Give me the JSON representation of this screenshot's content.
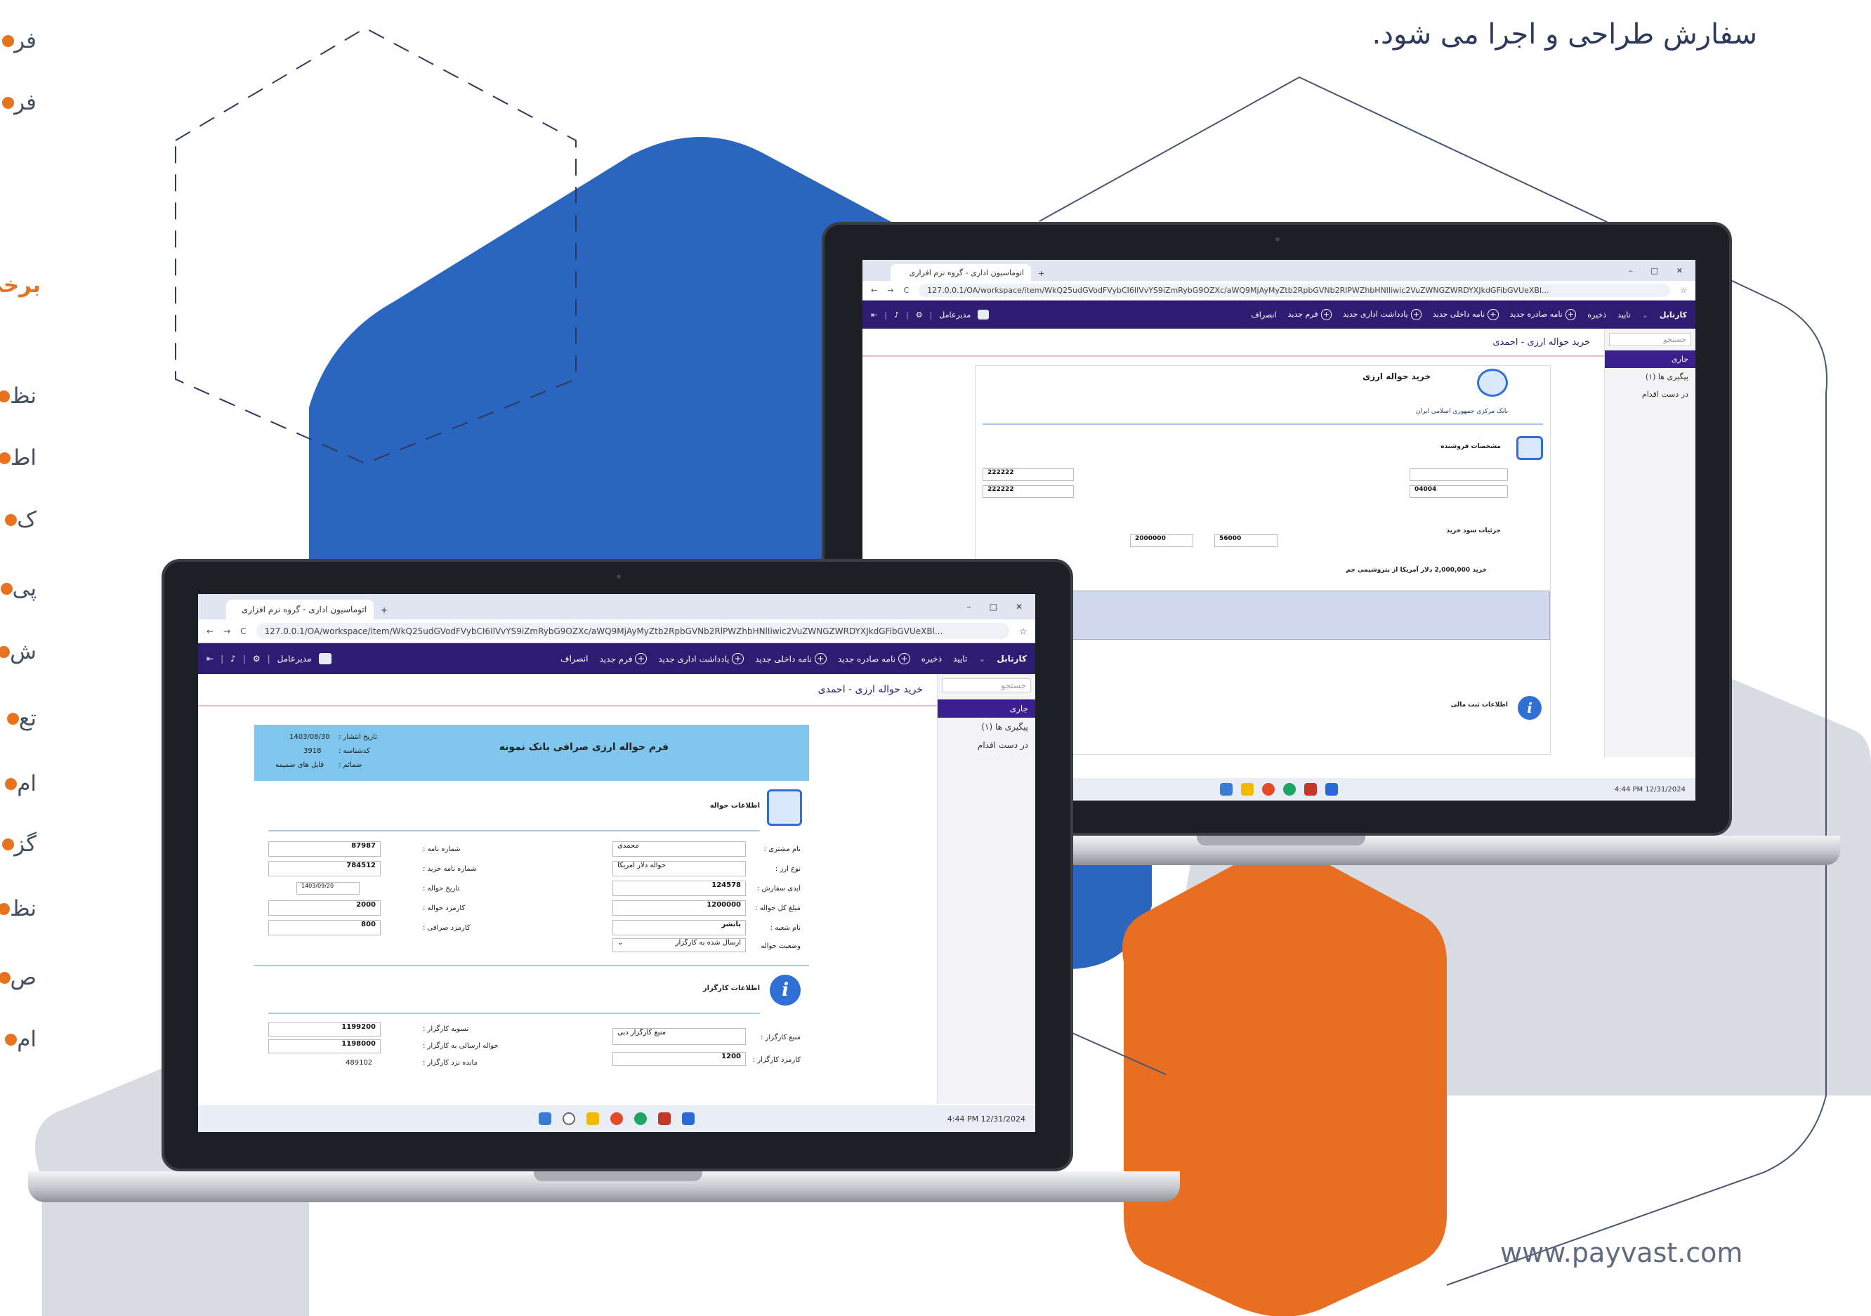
{
  "tagline": "سفارش طراحی و اجرا می شود.",
  "website": "www.payvast.com",
  "left_list": {
    "top": [
      "فر",
      "فر"
    ],
    "heading": "برخی",
    "items": [
      "نظ",
      "اط",
      "ک",
      "پی",
      "ش",
      "تع",
      "ام",
      "گز",
      "نظ",
      "ص",
      "ام"
    ]
  },
  "browser": {
    "tab_title": "اتوماسیون اداری - گروه نرم افزاری",
    "url": "127.0.0.1/OA/workspace/item/WkQ25udGVodFVybCI6IlVvYS9iZmRybG9OZXc/aWQ9MjAyMyZtb2RpbGVNb2RlPWZhbHNlIiwic2VuZWNGZWRDYXJkdGFibGVUeXBl..."
  },
  "app": {
    "cartable": "کارتابل",
    "toolbar": [
      "تایید",
      "ذخیره",
      "نامه صادره جدید",
      "نامه داخلی جدید",
      "یادداشت اداری جدید",
      "فرم جدید",
      "انصراف"
    ],
    "user": "مدیرعامل"
  },
  "sidebar": {
    "search": "جستجو",
    "items": [
      "جاری",
      "پیگیری ها (۱)",
      "در دست اقدام"
    ]
  },
  "pages": {
    "front_title": "خرید حواله ارزی - احمدی",
    "back_title": "خرید حواله ارزی - احمدی",
    "back_form_title": "خرید حواله ارزی",
    "back_bank": "بانک مرکزی جمهوری اسلامی ایران",
    "back_sections": [
      "مشخصات فروشنده",
      "جزئیات سود خرید",
      "اطلاعات ثبت مالی"
    ],
    "back_values": [
      "222222",
      "222222",
      "04004",
      "2000000",
      "56000"
    ],
    "back_summary": "خرید 2,000,000 دلار آمریکا از پتروشیمی جم"
  },
  "form": {
    "title": "فرم حواله ارزی صرافی بانک نمونه",
    "header": [
      {
        "label": "تاریخ انتشار :",
        "value": "1403/08/30"
      },
      {
        "label": "کدشناسه :",
        "value": "3918"
      },
      {
        "label": "ضمائم :",
        "value": "فایل های ضمیمه"
      }
    ],
    "section1": "اطلاعات حواله",
    "right_col": [
      {
        "label": "نام مشتری :",
        "value": "محمدی"
      },
      {
        "label": "نوع ارز :",
        "value": "حواله دلار امریکا"
      },
      {
        "label": "ایدی سفارش :",
        "value": "124578"
      },
      {
        "label": "مبلغ کل حواله :",
        "value": "1200000"
      },
      {
        "label": "نام شعبه :",
        "value": "بانشر"
      },
      {
        "label": "وضعیت حواله",
        "value": "ارسال شده به کارگزار"
      }
    ],
    "left_col": [
      {
        "label": "شماره نامه :",
        "value": "87987"
      },
      {
        "label": "شماره نامه خرید :",
        "value": "784512"
      },
      {
        "label": "تاریخ حواله :",
        "value": "1403/09/20"
      },
      {
        "label": "کارمزد حواله :",
        "value": "2000"
      },
      {
        "label": "کارمزد صرافی :",
        "value": "800"
      }
    ],
    "section2": "اطلاعات کارگزار",
    "agent_right": [
      {
        "label": "منبع کارگزار :",
        "value": "منبع کارگزار دبی"
      },
      {
        "label": "کارمزد کارگزار :",
        "value": "1200"
      }
    ],
    "agent_left": [
      {
        "label": "تسویه کارگزار :",
        "value": "1199200"
      },
      {
        "label": "حواله ارسالی به کارگزار :",
        "value": "1198000"
      },
      {
        "label": "مانده نزد کارگزار :",
        "value": "489102"
      }
    ]
  },
  "taskbar": {
    "time": "4:44 PM",
    "date": "12/31/2024"
  }
}
